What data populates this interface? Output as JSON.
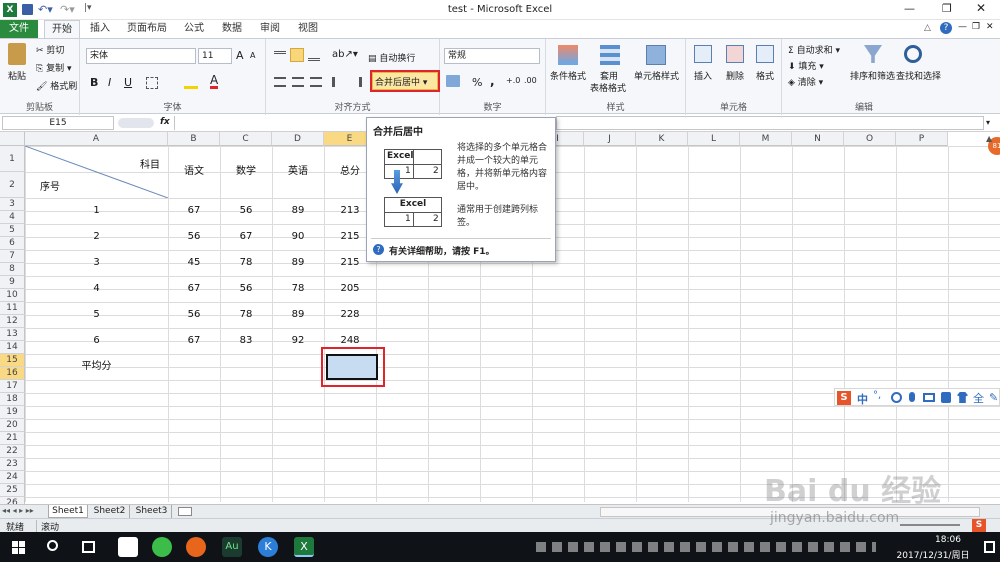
{
  "title": {
    "text": "test - Microsoft Excel"
  },
  "tabs": [
    "文件",
    "开始",
    "插入",
    "页面布局",
    "公式",
    "数据",
    "审阅",
    "视图"
  ],
  "ribbon": {
    "clipboard": {
      "paste": "粘贴",
      "cut": "剪切",
      "copy": "复制",
      "format_painter": "格式刷",
      "label": "剪贴板"
    },
    "font": {
      "name": "宋体",
      "size": "11",
      "bold": "B",
      "italic": "I",
      "underline": "U",
      "grow": "A",
      "shrink": "A",
      "label": "字体"
    },
    "align": {
      "wrap": "自动换行",
      "merge": "合并后居中",
      "label": "对齐方式"
    },
    "number": {
      "format": "常规",
      "percent": "%",
      "comma": ",",
      "label": "数字"
    },
    "styles": {
      "cond": "条件格式",
      "table1": "套用",
      "table2": "表格格式",
      "cellstyle": "单元格样式",
      "label": "样式"
    },
    "cells": {
      "insert": "插入",
      "delete": "删除",
      "format": "格式",
      "label": "单元格"
    },
    "editing": {
      "autosum": "自动求和",
      "fill": "填充",
      "clear": "清除",
      "sort": "排序和筛选",
      "find": "查找和选择",
      "label": "编辑"
    }
  },
  "formula": {
    "namebox": "E15",
    "fx": "fx",
    "value": ""
  },
  "columns": [
    "A",
    "B",
    "C",
    "D",
    "E",
    "F",
    "G",
    "H",
    "I",
    "J",
    "K",
    "L",
    "M",
    "N",
    "O",
    "P"
  ],
  "rows": [
    "1",
    "2",
    "3",
    "4",
    "5",
    "6",
    "7",
    "8",
    "9",
    "10",
    "11",
    "12",
    "13",
    "14",
    "15",
    "16",
    "17",
    "18",
    "19",
    "20",
    "21",
    "22",
    "23",
    "24",
    "25",
    "26"
  ],
  "table": {
    "header_subject": "科目",
    "header_seq": "序号",
    "headers": [
      "语文",
      "数学",
      "英语",
      "总分"
    ],
    "records": [
      {
        "id": "1",
        "v": [
          "67",
          "56",
          "89",
          "213"
        ]
      },
      {
        "id": "2",
        "v": [
          "56",
          "67",
          "90",
          "215"
        ]
      },
      {
        "id": "3",
        "v": [
          "45",
          "78",
          "89",
          "215"
        ]
      },
      {
        "id": "4",
        "v": [
          "67",
          "56",
          "78",
          "205"
        ]
      },
      {
        "id": "5",
        "v": [
          "56",
          "78",
          "89",
          "228"
        ]
      },
      {
        "id": "6",
        "v": [
          "67",
          "83",
          "92",
          "248"
        ]
      }
    ],
    "average": "平均分"
  },
  "tooltip": {
    "title": "合并后居中",
    "desc": "将选择的多个单元格合并成一个较大的单元格，并将新单元格内容居中。",
    "note": "通常用于创建跨列标签。",
    "example_word": "Excel",
    "example_n1": "1",
    "example_n2": "2",
    "help": "有关详细帮助，请按 F1。"
  },
  "sheets": [
    "Sheet1",
    "Sheet2",
    "Sheet3"
  ],
  "status": {
    "ready": "就绪",
    "scroll": "滚动"
  },
  "ime": {
    "lang": "中",
    "punct": "°,"
  },
  "watermark": {
    "brand": "Bai du 经验",
    "url": "jingyan.baidu.com"
  },
  "clock": {
    "time": "18:06",
    "date": "2017/12/31/周日"
  },
  "colors": {
    "accent": "#217346",
    "selected": "#c7dcf0",
    "red": "#e0242c",
    "file_tab": "#2a8a3e"
  }
}
